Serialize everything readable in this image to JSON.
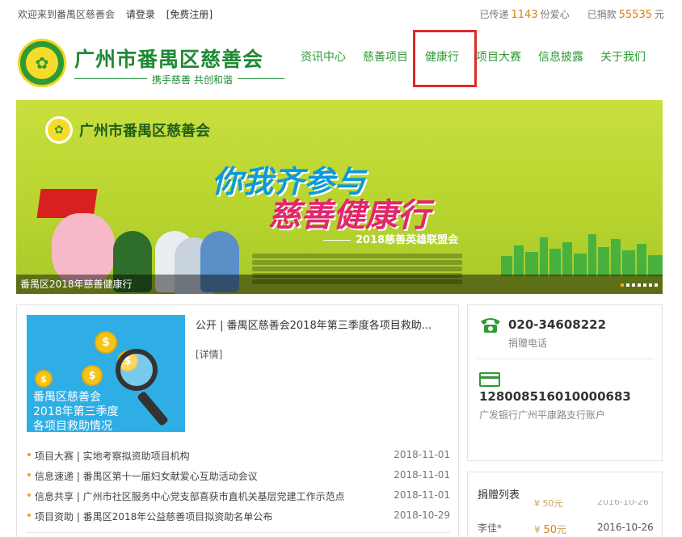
{
  "topbar": {
    "welcome": "欢迎来到番禺区慈善会",
    "login": "请登录",
    "register": "[免费注册]",
    "love_prefix": "已传递",
    "love_count": "1143",
    "love_suffix": "份爱心",
    "donation_prefix": "已捐款",
    "donation_amount": "55535",
    "donation_suffix": "元"
  },
  "header": {
    "org_name": "广州市番禺区慈善会",
    "slogan": "携手慈善 共创和谐"
  },
  "nav": {
    "items": [
      {
        "label": "资讯中心"
      },
      {
        "label": "慈善项目"
      },
      {
        "label": "健康行"
      },
      {
        "label": "项目大赛"
      },
      {
        "label": "信息披露"
      },
      {
        "label": "关于我们"
      }
    ],
    "active_index": 2
  },
  "banner": {
    "org_name": "广州市番禺区慈善会",
    "headline_1": "你我齐参与",
    "headline_2": "慈善健康行",
    "subline": "2018慈善英雄联盟会",
    "caption": "番禺区2018年慈善健康行",
    "slide_count": 7,
    "active_slide": 0
  },
  "feature": {
    "image_text": [
      "番禺区慈善会",
      "2018年第三季度",
      "各项目救助情况"
    ],
    "title": "公开 | 番禺区慈善会2018年第三季度各项目救助...",
    "detail_link": "[详情]"
  },
  "news": [
    {
      "title": "项目大赛 | 实地考察拟资助项目机构",
      "date": "2018-11-01"
    },
    {
      "title": "信息速递 | 番禺区第十一届妇女献爱心互助活动会议",
      "date": "2018-11-01"
    },
    {
      "title": "信息共享 | 广州市社区服务中心党支部喜获市直机关基层党建工作示范点",
      "date": "2018-11-01"
    },
    {
      "title": "项目资助 | 番禺区2018年公益慈善项目拟资助名单公布",
      "date": "2018-10-29"
    }
  ],
  "contact": {
    "phone": "020-34608222",
    "phone_label": "捐赠电话",
    "account": "128008516010000683",
    "account_label": "广发银行广州平康路支行账户"
  },
  "donations": {
    "title": "捐赠列表",
    "ghost_amount": "¥ 50元",
    "ghost_date": "2016-10-26",
    "rows": [
      {
        "name": "李佳*",
        "currency": "¥",
        "amount": "50",
        "unit": "元",
        "date": "2016-10-26"
      }
    ]
  },
  "colors": {
    "brand_green": "#2e9a35",
    "accent_orange": "#e07d10",
    "highlight_red": "#e02828"
  }
}
